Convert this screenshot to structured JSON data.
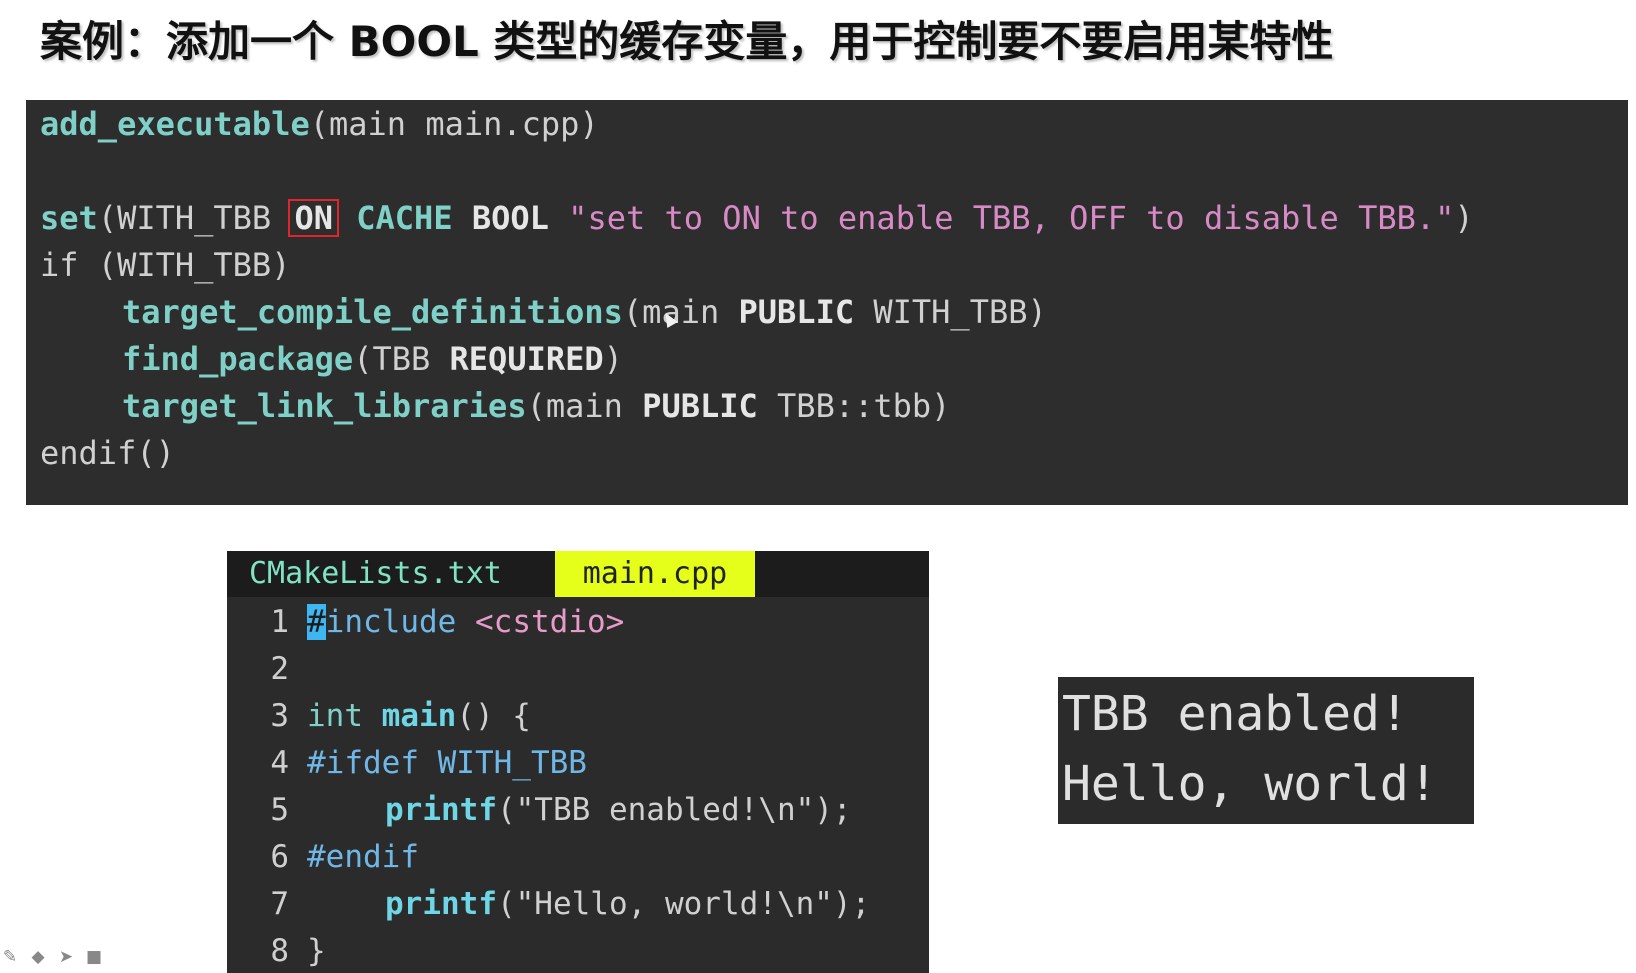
{
  "slide": {
    "title": "案例：添加一个 BOOL 类型的缓存变量，用于控制要不要启用某特性"
  },
  "cmake_code": {
    "line1": {
      "fn": "add_executable",
      "rest": "(main main.cpp)"
    },
    "line3": {
      "fn": "set",
      "open": "(WITH_TBB ",
      "on": "ON",
      "cache": " CACHE",
      "bool": " BOOL",
      "str": " \"set to ON to enable TBB, OFF to disable TBB.\"",
      "close": ")"
    },
    "line4": "if (WITH_TBB)",
    "line5": {
      "fn": "target_compile_definitions",
      "a": "(main ",
      "kw": "PUBLIC",
      "b": " WITH_TBB)"
    },
    "line6": {
      "fn": "find_package",
      "a": "(TBB ",
      "kw": "REQUIRED",
      "b": ")"
    },
    "line7": {
      "fn": "target_link_libraries",
      "a": "(main ",
      "kw": "PUBLIC",
      "b": " TBB::tbb)"
    },
    "line8": "endif()"
  },
  "editor": {
    "tabs": [
      "CMakeLists.txt",
      "main.cpp"
    ],
    "active_tab": "main.cpp",
    "lines": {
      "n1": "1",
      "l1_cursor": "#",
      "l1_pp": "include",
      "l1_inc": " <cstdio>",
      "n2": "2",
      "n3": "3",
      "l3_type": "int ",
      "l3_fn": "main",
      "l3_rest": "() {",
      "n4": "4",
      "l4": "#ifdef WITH_TBB",
      "n5": "5",
      "l5_fn": "printf",
      "l5_rest": "(\"TBB enabled!\\n\");",
      "n6": "6",
      "l6": "#endif",
      "n7": "7",
      "l7_fn": "printf",
      "l7_rest": "(\"Hello, world!\\n\");",
      "n8": "8",
      "l8": "}"
    }
  },
  "terminal": {
    "line1": "TBB enabled!",
    "line2": "Hello, world!"
  },
  "toolbar": {
    "icons": [
      "pen-icon",
      "eraser-icon",
      "pointer-icon",
      "camera-icon"
    ]
  },
  "colors": {
    "function": "#7fd1c8",
    "string": "#d88ac7",
    "highlight_box": "#e0262a",
    "active_tab": "#e6ff1a",
    "cursor": "#3db6f2"
  }
}
